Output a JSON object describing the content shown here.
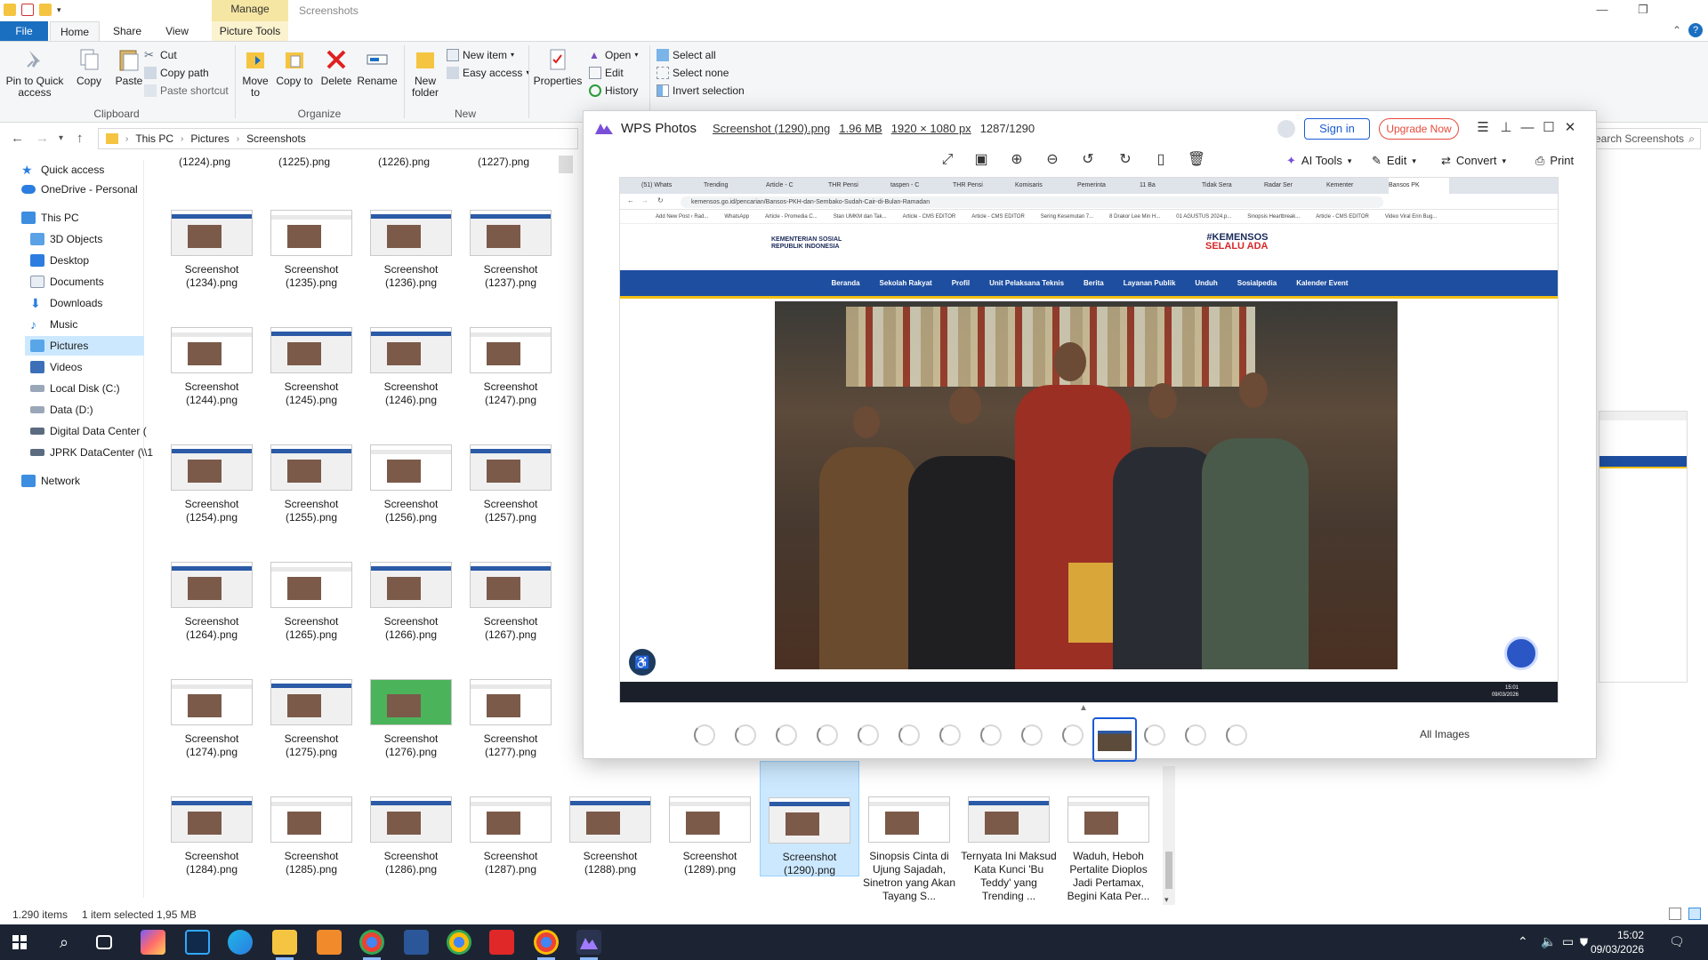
{
  "explorer": {
    "window_title": "Screenshots",
    "manage_label": "Manage",
    "tabs": [
      "File",
      "Home",
      "Share",
      "View",
      "Picture Tools"
    ],
    "ribbon": {
      "clipboard": {
        "pin": "Pin to Quick access",
        "copy": "Copy",
        "paste": "Paste",
        "cut": "Cut",
        "copy_path": "Copy path",
        "paste_shortcut": "Paste shortcut",
        "label": "Clipboard"
      },
      "organize": {
        "move_to": "Move to",
        "copy_to": "Copy to",
        "delete": "Delete",
        "rename": "Rename",
        "label": "Organize"
      },
      "new": {
        "new_folder": "New folder",
        "new_item": "New item",
        "easy_access": "Easy access",
        "label": "New"
      },
      "open": {
        "properties": "Properties",
        "open": "Open",
        "edit": "Edit",
        "history": "History"
      },
      "select": {
        "select_all": "Select all",
        "select_none": "Select none",
        "invert": "Invert selection"
      }
    },
    "address": {
      "crumbs": [
        "This PC",
        "Pictures",
        "Screenshots"
      ],
      "search_placeholder": "Search Screenshots"
    },
    "nav": {
      "quick_access": "Quick access",
      "onedrive": "OneDrive - Personal",
      "this_pc": "This PC",
      "objects": "3D Objects",
      "desktop": "Desktop",
      "documents": "Documents",
      "downloads": "Downloads",
      "music": "Music",
      "pictures": "Pictures",
      "videos": "Videos",
      "local_disk": "Local Disk (C:)",
      "data_d": "Data (D:)",
      "digital": "Digital Data Center (",
      "jprk": "JPRK DataCenter (\\\\1",
      "network": "Network"
    },
    "top_labels": [
      "(1224).png",
      "(1225).png",
      "(1226).png",
      "(1227).png"
    ],
    "rows": [
      [
        "Screenshot (1234).png",
        "Screenshot (1235).png",
        "Screenshot (1236).png",
        "Screenshot (1237).png"
      ],
      [
        "Screenshot (1244).png",
        "Screenshot (1245).png",
        "Screenshot (1246).png",
        "Screenshot (1247).png"
      ],
      [
        "Screenshot (1254).png",
        "Screenshot (1255).png",
        "Screenshot (1256).png",
        "Screenshot (1257).png"
      ],
      [
        "Screenshot (1264).png",
        "Screenshot (1265).png",
        "Screenshot (1266).png",
        "Screenshot (1267).png"
      ],
      [
        "Screenshot (1274).png",
        "Screenshot (1275).png",
        "Screenshot (1276).png",
        "Screenshot (1277).png"
      ]
    ],
    "last_row": [
      "Screenshot (1284).png",
      "Screenshot (1285).png",
      "Screenshot (1286).png",
      "Screenshot (1287).png",
      "Screenshot (1288).png",
      "Screenshot (1289).png",
      "Screenshot (1290).png",
      "Sinopsis Cinta di Ujung Sajadah, Sinetron yang Akan Tayang S...",
      "Ternyata Ini Maksud Kata Kunci 'Bu Teddy' yang Trending ...",
      "Waduh, Heboh Pertalite Dioplos Jadi Pertamax, Begini Kata Per..."
    ],
    "status": {
      "items": "1.290 items",
      "selected": "1 item selected  1,95 MB"
    }
  },
  "wps": {
    "app_name": "WPS Photos",
    "file_name": "Screenshot (1290).png",
    "file_size": "1.96 MB",
    "dimensions": "1920 × 1080 px",
    "index": "1287/1290",
    "sign_in": "Sign in",
    "upgrade": "Upgrade Now",
    "ai_tools": "AI Tools",
    "edit": "Edit",
    "convert": "Convert",
    "print": "Print",
    "all_images": "All Images",
    "inner": {
      "tabs": [
        "(51) Whats",
        "Trending",
        "Article - C",
        "THR Pensi",
        "taspen - C",
        "THR Pensi",
        "Komisaris",
        "Pemerinta",
        "11 Ba",
        "Tidak Sera",
        "Radar Ser",
        "Kementer",
        "Bansos PK"
      ],
      "url": "kemensos.go.id/pencarian/Bansos-PKH-dan-Sembako-Sudah-Cair-di-Bulan-Ramadan",
      "bookmarks": [
        "Add New Post ‹ Rad...",
        "WhatsApp",
        "Article - Promedia C...",
        "Stan UMKM dan Tak...",
        "Article - CMS EDITOR",
        "Article - CMS EDITOR",
        "Sering Kesemutan 7...",
        "8 Drakor Lee Min H...",
        "01 AGUSTUS 2024.p...",
        "Sinopsis Heartbreak...",
        "Article - CMS EDITOR",
        "Video Viral Erin Bug..."
      ],
      "logo_line1": "KEMENTERIAN SOSIAL",
      "logo_line2": "REPUBLIK INDONESIA",
      "tag_line1": "#KEMENSOS",
      "tag_line2": "SELALU ADA",
      "nav": [
        "Beranda",
        "Sekolah Rakyat",
        "Profil",
        "Unit Pelaksana Teknis",
        "Berita",
        "Layanan Publik",
        "Unduh",
        "Sosialpedia",
        "Kalender Event"
      ],
      "clock_time": "15:01",
      "clock_date": "09/03/2026"
    }
  },
  "taskbar": {
    "time": "15:02",
    "date": "09/03/2026"
  },
  "colors": {
    "accent": "#1a6fc1",
    "selection": "#cce8ff",
    "manage": "#f6e6a3",
    "site_nav": "#1d4ea0",
    "site_accent": "#f2c013",
    "taskbar": "#1c2433"
  }
}
